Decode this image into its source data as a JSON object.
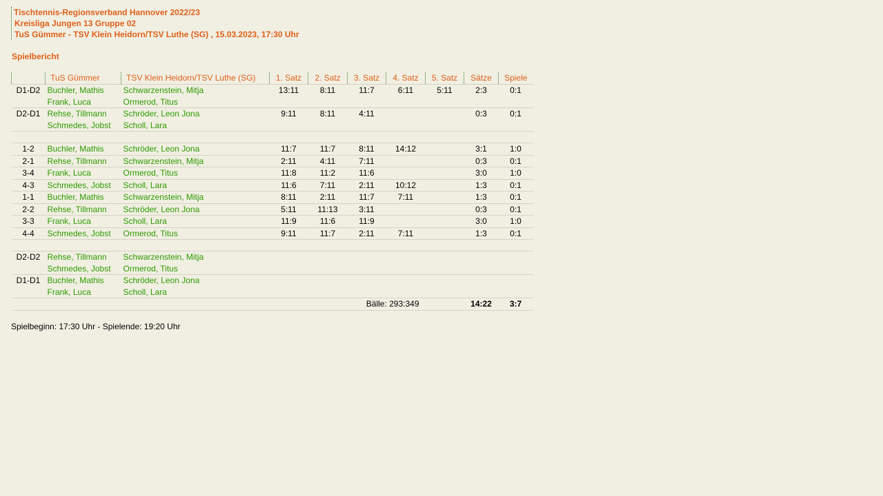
{
  "header": {
    "line1": "Tischtennis-Regionsverband Hannover 2022/23",
    "line2": "Kreisliga Jungen 13 Gruppe 02",
    "line3": "TuS Gümmer - TSV Klein Heidorn/TSV Luthe (SG) , 15.03.2023, 17:30 Uhr"
  },
  "section_title": "Spielbericht",
  "columns": {
    "code": "",
    "home": "TuS Gümmer",
    "away": "TSV Klein Heidorn/TSV Luthe (SG)",
    "s1": "1. Satz",
    "s2": "2. Satz",
    "s3": "3. Satz",
    "s4": "4. Satz",
    "s5": "5. Satz",
    "saetze": "Sätze",
    "spiele": "Spiele"
  },
  "doubles_top": [
    {
      "code": "D1-D2",
      "home1": "Buchler, Mathis",
      "home2": "Frank, Luca",
      "away1": "Schwarzenstein, Mitja",
      "away2": "Ormerod, Titus",
      "s1": "13:11",
      "s2": "8:11",
      "s3": "11:7",
      "s4": "6:11",
      "s5": "5:11",
      "saetze": "2:3",
      "spiele": "0:1"
    },
    {
      "code": "D2-D1",
      "home1": "Rehse, Tillmann",
      "home2": "Schmedes, Jobst",
      "away1": "Schröder, Leon Jona",
      "away2": "Scholl, Lara",
      "s1": "9:11",
      "s2": "8:11",
      "s3": "4:11",
      "s4": "",
      "s5": "",
      "saetze": "0:3",
      "spiele": "0:1"
    }
  ],
  "singles": [
    {
      "code": "1-2",
      "home": "Buchler, Mathis",
      "away": "Schröder, Leon Jona",
      "s1": "11:7",
      "s2": "11:7",
      "s3": "8:11",
      "s4": "14:12",
      "s5": "",
      "saetze": "3:1",
      "spiele": "1:0"
    },
    {
      "code": "2-1",
      "home": "Rehse, Tillmann",
      "away": "Schwarzenstein, Mitja",
      "s1": "2:11",
      "s2": "4:11",
      "s3": "7:11",
      "s4": "",
      "s5": "",
      "saetze": "0:3",
      "spiele": "0:1"
    },
    {
      "code": "3-4",
      "home": "Frank, Luca",
      "away": "Ormerod, Titus",
      "s1": "11:8",
      "s2": "11:2",
      "s3": "11:6",
      "s4": "",
      "s5": "",
      "saetze": "3:0",
      "spiele": "1:0"
    },
    {
      "code": "4-3",
      "home": "Schmedes, Jobst",
      "away": "Scholl, Lara",
      "s1": "11:6",
      "s2": "7:11",
      "s3": "2:11",
      "s4": "10:12",
      "s5": "",
      "saetze": "1:3",
      "spiele": "0:1"
    },
    {
      "code": "1-1",
      "home": "Buchler, Mathis",
      "away": "Schwarzenstein, Mitja",
      "s1": "8:11",
      "s2": "2:11",
      "s3": "11:7",
      "s4": "7:11",
      "s5": "",
      "saetze": "1:3",
      "spiele": "0:1"
    },
    {
      "code": "2-2",
      "home": "Rehse, Tillmann",
      "away": "Schröder, Leon Jona",
      "s1": "5:11",
      "s2": "11:13",
      "s3": "3:11",
      "s4": "",
      "s5": "",
      "saetze": "0:3",
      "spiele": "0:1"
    },
    {
      "code": "3-3",
      "home": "Frank, Luca",
      "away": "Scholl, Lara",
      "s1": "11:9",
      "s2": "11:6",
      "s3": "11:9",
      "s4": "",
      "s5": "",
      "saetze": "3:0",
      "spiele": "1:0"
    },
    {
      "code": "4-4",
      "home": "Schmedes, Jobst",
      "away": "Ormerod, Titus",
      "s1": "9:11",
      "s2": "11:7",
      "s3": "2:11",
      "s4": "7:11",
      "s5": "",
      "saetze": "1:3",
      "spiele": "0:1"
    }
  ],
  "doubles_bottom": [
    {
      "code": "D2-D2",
      "home1": "Rehse, Tillmann",
      "home2": "Schmedes, Jobst",
      "away1": "Schwarzenstein, Mitja",
      "away2": "Ormerod, Titus"
    },
    {
      "code": "D1-D1",
      "home1": "Buchler, Mathis",
      "home2": "Frank, Luca",
      "away1": "Schröder, Leon Jona",
      "away2": "Scholl, Lara"
    }
  ],
  "totals": {
    "balls": "Bälle: 293:349",
    "saetze": "14:22",
    "spiele": "3:7"
  },
  "footer": "Spielbeginn: 17:30 Uhr - Spielende: 19:20 Uhr"
}
